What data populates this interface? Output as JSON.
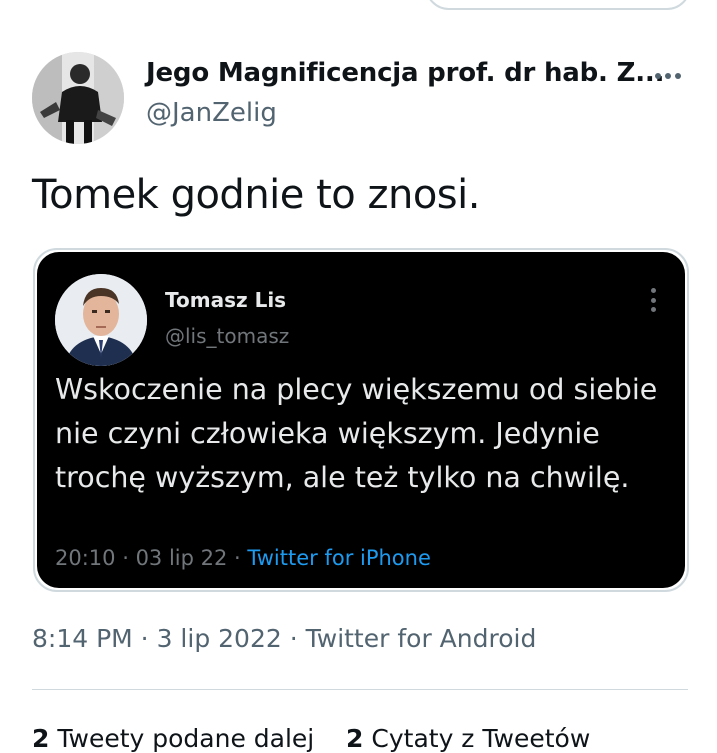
{
  "tweet": {
    "display_name": "Jego Magnificencja prof. dr hab. Z...",
    "handle": "@JanZelig",
    "text": "Tomek godnie to znosi.",
    "time": "8:14 PM",
    "date": "3 lip 2022",
    "source": "Twitter for Android",
    "separator": " · "
  },
  "quoted": {
    "name": "Tomasz Lis",
    "handle": "@lis_tomasz",
    "text": "Wskoczenie na plecy większemu od siebie nie czyni człowieka większym. Jedynie trochę wyższym, ale też tylko na chwilę.",
    "time": "20:10",
    "date": "03 lip 22",
    "source": "Twitter for iPhone",
    "separator": " · "
  },
  "stats": {
    "retweets_count": "2",
    "retweets_label": "Tweety podane dalej",
    "quotes_count": "2",
    "quotes_label": "Cytaty z Tweetów"
  },
  "icons": {
    "more": "more-horizontal-icon",
    "quoted_more": "more-vertical-icon"
  },
  "colors": {
    "text_primary": "#0f1419",
    "text_secondary": "#536471",
    "link_blue": "#1d9bf0",
    "quote_bg": "#000000"
  }
}
